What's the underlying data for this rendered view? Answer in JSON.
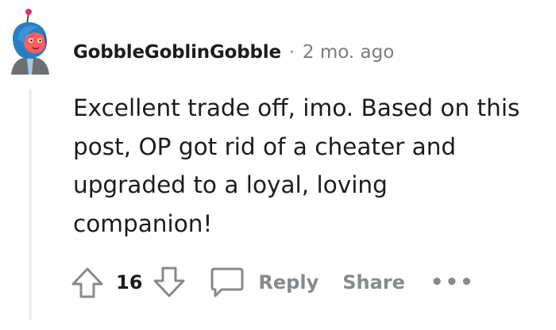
{
  "comment": {
    "username": "GobbleGoblinGobble",
    "separator": "·",
    "timestamp": "2 mo. ago",
    "body_lines": [
      "Excellent trade off, imo. Based on this",
      "post, OP got rid of a cheater and",
      "upgraded to a loyal, loving",
      "companion!"
    ],
    "vote_count": "16",
    "reply_label": "Reply",
    "share_label": "Share",
    "more_label": "•••"
  },
  "icons": {
    "upvote": "arrow-up-outline",
    "downvote": "arrow-down-outline",
    "reply": "speech-bubble-outline",
    "avatar": "snoo-avatar"
  },
  "colors": {
    "text_primary": "#1c1c1c",
    "text_muted": "#7c7c7c",
    "action_gray": "#878a8c",
    "thread_line": "#edeff1",
    "avatar_hair": "#2a7fc4",
    "avatar_face": "#ff5e5e",
    "avatar_antenna": "#d6336c"
  }
}
